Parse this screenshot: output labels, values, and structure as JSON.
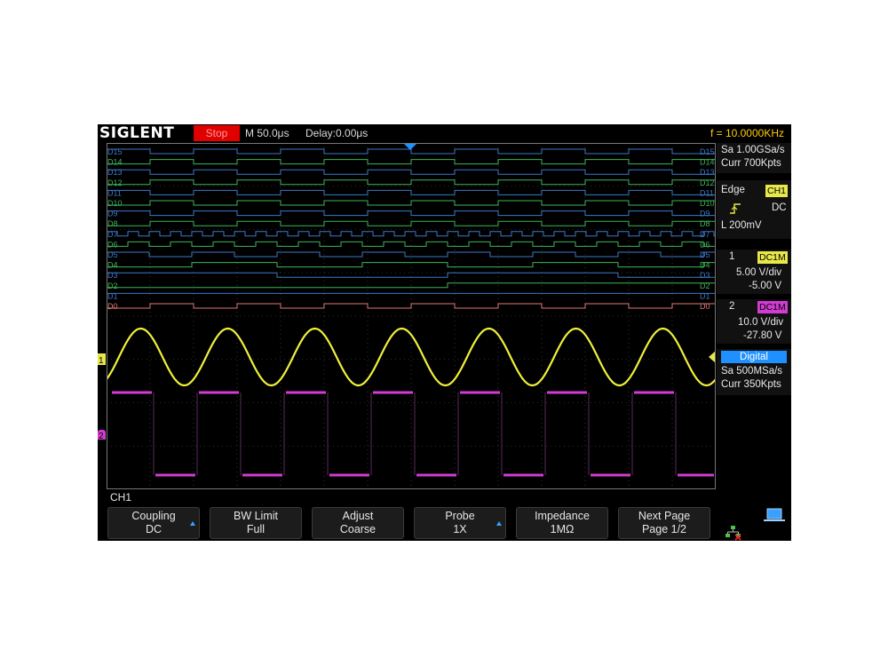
{
  "topbar": {
    "brand": "SIGLENT",
    "run_state": "Stop",
    "timebase": "M 50.0μs",
    "delay": "Delay:0.00μs",
    "frequency": "f = 10.0000KHz"
  },
  "side": {
    "acq_rate": "Sa 1.00GSa/s",
    "acq_depth": "Curr 700Kpts",
    "trigger": {
      "type": "Edge",
      "source": "CH1",
      "coupling": "DC",
      "level": "L  200mV"
    },
    "ch1": {
      "num": "1",
      "badge": "DC1M",
      "scale": "5.00 V/div",
      "offset": "-5.00 V"
    },
    "ch2": {
      "num": "2",
      "badge": "DC1M",
      "scale": "10.0 V/div",
      "offset": "-27.80 V"
    },
    "digital": {
      "title": "Digital",
      "rate": "Sa 500MSa/s",
      "depth": "Curr 350Kpts"
    }
  },
  "active_channel": "CH1",
  "softkeys": [
    {
      "line1": "Coupling",
      "line2": "DC",
      "arrow": true
    },
    {
      "line1": "BW Limit",
      "line2": "Full",
      "arrow": false
    },
    {
      "line1": "Adjust",
      "line2": "Coarse",
      "arrow": false
    },
    {
      "line1": "Probe",
      "line2": "1X",
      "arrow": true
    },
    {
      "line1": "Impedance",
      "line2": "1MΩ",
      "arrow": false
    },
    {
      "line1": "Next Page",
      "line2": "Page 1/2",
      "arrow": false
    }
  ],
  "digital_labels": [
    "D15",
    "D14",
    "D13",
    "D12",
    "D11",
    "D10",
    "D9",
    "D8",
    "D7",
    "D6",
    "D5",
    "D4",
    "D3",
    "D2",
    "D1",
    "D0"
  ],
  "colors": {
    "ch1": "#f0f03c",
    "ch2": "#d23cd2",
    "digital_blue": "#3c78c8",
    "digital_green": "#3cb45a",
    "d0": "#e07878",
    "run_state": "#e00000",
    "frequency": "#ffcc00",
    "badge_ch1": "#e8e84a",
    "badge_ch2": "#d23cd2",
    "digital_badge": "#1e90ff"
  }
}
